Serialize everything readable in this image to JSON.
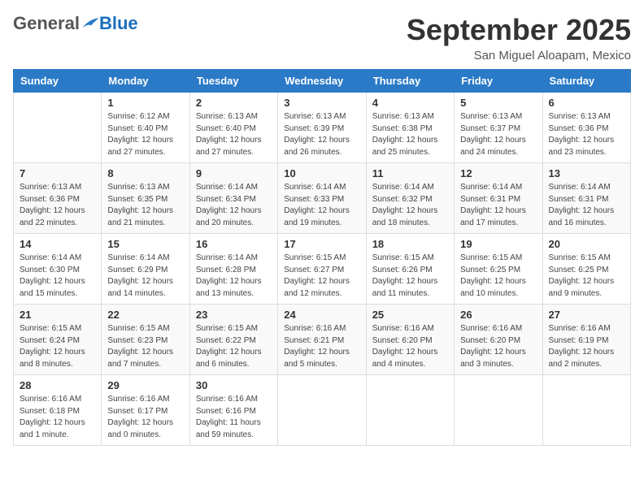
{
  "header": {
    "logo_general": "General",
    "logo_blue": "Blue",
    "month_title": "September 2025",
    "location": "San Miguel Aloapam, Mexico"
  },
  "weekdays": [
    "Sunday",
    "Monday",
    "Tuesday",
    "Wednesday",
    "Thursday",
    "Friday",
    "Saturday"
  ],
  "weeks": [
    [
      {
        "day": "",
        "info": ""
      },
      {
        "day": "1",
        "info": "Sunrise: 6:12 AM\nSunset: 6:40 PM\nDaylight: 12 hours\nand 27 minutes."
      },
      {
        "day": "2",
        "info": "Sunrise: 6:13 AM\nSunset: 6:40 PM\nDaylight: 12 hours\nand 27 minutes."
      },
      {
        "day": "3",
        "info": "Sunrise: 6:13 AM\nSunset: 6:39 PM\nDaylight: 12 hours\nand 26 minutes."
      },
      {
        "day": "4",
        "info": "Sunrise: 6:13 AM\nSunset: 6:38 PM\nDaylight: 12 hours\nand 25 minutes."
      },
      {
        "day": "5",
        "info": "Sunrise: 6:13 AM\nSunset: 6:37 PM\nDaylight: 12 hours\nand 24 minutes."
      },
      {
        "day": "6",
        "info": "Sunrise: 6:13 AM\nSunset: 6:36 PM\nDaylight: 12 hours\nand 23 minutes."
      }
    ],
    [
      {
        "day": "7",
        "info": "Sunrise: 6:13 AM\nSunset: 6:36 PM\nDaylight: 12 hours\nand 22 minutes."
      },
      {
        "day": "8",
        "info": "Sunrise: 6:13 AM\nSunset: 6:35 PM\nDaylight: 12 hours\nand 21 minutes."
      },
      {
        "day": "9",
        "info": "Sunrise: 6:14 AM\nSunset: 6:34 PM\nDaylight: 12 hours\nand 20 minutes."
      },
      {
        "day": "10",
        "info": "Sunrise: 6:14 AM\nSunset: 6:33 PM\nDaylight: 12 hours\nand 19 minutes."
      },
      {
        "day": "11",
        "info": "Sunrise: 6:14 AM\nSunset: 6:32 PM\nDaylight: 12 hours\nand 18 minutes."
      },
      {
        "day": "12",
        "info": "Sunrise: 6:14 AM\nSunset: 6:31 PM\nDaylight: 12 hours\nand 17 minutes."
      },
      {
        "day": "13",
        "info": "Sunrise: 6:14 AM\nSunset: 6:31 PM\nDaylight: 12 hours\nand 16 minutes."
      }
    ],
    [
      {
        "day": "14",
        "info": "Sunrise: 6:14 AM\nSunset: 6:30 PM\nDaylight: 12 hours\nand 15 minutes."
      },
      {
        "day": "15",
        "info": "Sunrise: 6:14 AM\nSunset: 6:29 PM\nDaylight: 12 hours\nand 14 minutes."
      },
      {
        "day": "16",
        "info": "Sunrise: 6:14 AM\nSunset: 6:28 PM\nDaylight: 12 hours\nand 13 minutes."
      },
      {
        "day": "17",
        "info": "Sunrise: 6:15 AM\nSunset: 6:27 PM\nDaylight: 12 hours\nand 12 minutes."
      },
      {
        "day": "18",
        "info": "Sunrise: 6:15 AM\nSunset: 6:26 PM\nDaylight: 12 hours\nand 11 minutes."
      },
      {
        "day": "19",
        "info": "Sunrise: 6:15 AM\nSunset: 6:25 PM\nDaylight: 12 hours\nand 10 minutes."
      },
      {
        "day": "20",
        "info": "Sunrise: 6:15 AM\nSunset: 6:25 PM\nDaylight: 12 hours\nand 9 minutes."
      }
    ],
    [
      {
        "day": "21",
        "info": "Sunrise: 6:15 AM\nSunset: 6:24 PM\nDaylight: 12 hours\nand 8 minutes."
      },
      {
        "day": "22",
        "info": "Sunrise: 6:15 AM\nSunset: 6:23 PM\nDaylight: 12 hours\nand 7 minutes."
      },
      {
        "day": "23",
        "info": "Sunrise: 6:15 AM\nSunset: 6:22 PM\nDaylight: 12 hours\nand 6 minutes."
      },
      {
        "day": "24",
        "info": "Sunrise: 6:16 AM\nSunset: 6:21 PM\nDaylight: 12 hours\nand 5 minutes."
      },
      {
        "day": "25",
        "info": "Sunrise: 6:16 AM\nSunset: 6:20 PM\nDaylight: 12 hours\nand 4 minutes."
      },
      {
        "day": "26",
        "info": "Sunrise: 6:16 AM\nSunset: 6:20 PM\nDaylight: 12 hours\nand 3 minutes."
      },
      {
        "day": "27",
        "info": "Sunrise: 6:16 AM\nSunset: 6:19 PM\nDaylight: 12 hours\nand 2 minutes."
      }
    ],
    [
      {
        "day": "28",
        "info": "Sunrise: 6:16 AM\nSunset: 6:18 PM\nDaylight: 12 hours\nand 1 minute."
      },
      {
        "day": "29",
        "info": "Sunrise: 6:16 AM\nSunset: 6:17 PM\nDaylight: 12 hours\nand 0 minutes."
      },
      {
        "day": "30",
        "info": "Sunrise: 6:16 AM\nSunset: 6:16 PM\nDaylight: 11 hours\nand 59 minutes."
      },
      {
        "day": "",
        "info": ""
      },
      {
        "day": "",
        "info": ""
      },
      {
        "day": "",
        "info": ""
      },
      {
        "day": "",
        "info": ""
      }
    ]
  ]
}
